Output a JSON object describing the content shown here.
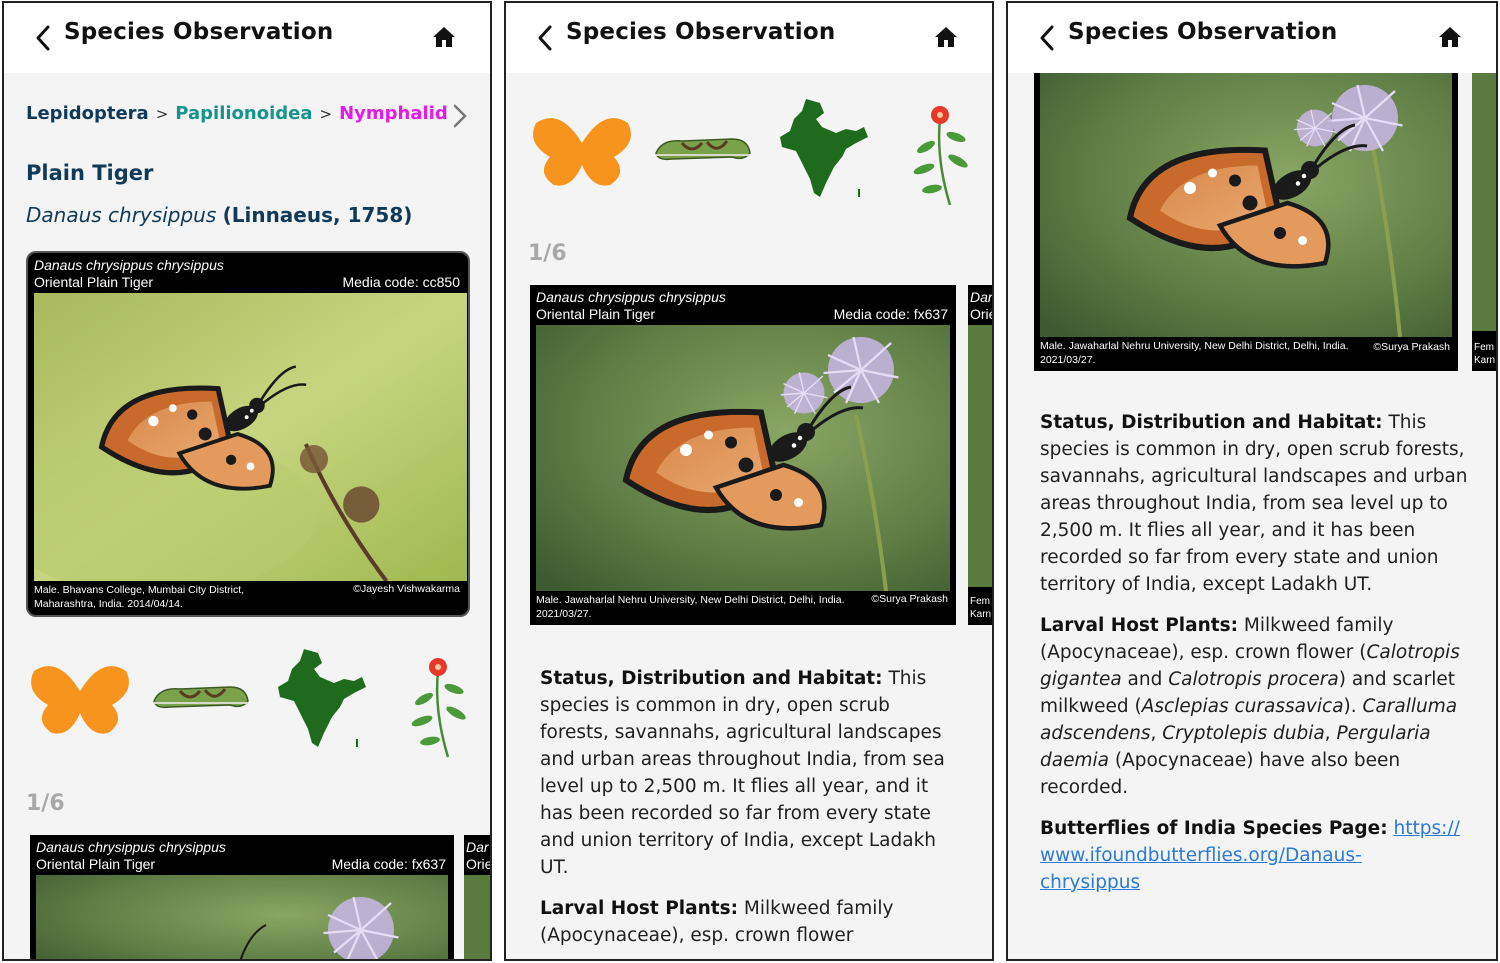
{
  "header": {
    "title": "Species Observation"
  },
  "breadcrumb": {
    "order": "Lepidoptera",
    "superfamily": "Papilionoidea",
    "family": "Nymphalid",
    "separator": ">"
  },
  "species": {
    "common_name": "Plain Tiger",
    "scientific_name": "Danaus chrysippus",
    "authority": "(Linnaeus, 1758)"
  },
  "media_cards": [
    {
      "subspecies": "Danaus chrysippus chrysippus",
      "common": "Oriental Plain Tiger",
      "media_code": "Media code: cc850",
      "location_line1": "Male. Bhavans College, Mumbai City District,",
      "location_line2": "Maharashtra, India. 2014/04/14.",
      "credit": "©Jayesh Vishwakarma"
    },
    {
      "subspecies": "Danaus chrysippus chrysippus",
      "common": "Oriental Plain Tiger",
      "media_code": "Media code: fx637",
      "location_line1": "Male. Jawaharlal Nehru University, New Delhi District, Delhi, India.",
      "location_line2": "2021/03/27.",
      "credit": "©Surya Prakash"
    }
  ],
  "peek_card": {
    "line1": "Dar",
    "line2": "Orie",
    "foot1": "Fem",
    "foot2": "Karn"
  },
  "icons": [
    "butterfly-icon",
    "caterpillar-icon",
    "india-map-icon",
    "host-plant-icon"
  ],
  "counter": "1/6",
  "description": {
    "status_label": "Status, Distribution and Habitat:",
    "status_text": "This species is common in dry, open scrub forests, savannahs, agricultural landscapes and urban areas throughout India, from sea level up to 2,500 m. It flies all year, and it has been recorded so far from every state and union territory of India, except Ladakh UT.",
    "host_label": "Larval Host Plants:",
    "host_text_1": "Milkweed family (Apocynaceae), esp. crown flower (",
    "host_sp_1": "Calotropis gigantea",
    "host_and": " and ",
    "host_sp_2": "Calotropis procera",
    "host_text_2": ") and scarlet milkweed (",
    "host_sp_3": "Asclepias curassavica",
    "host_text_3": "). ",
    "host_sp_4": "Caralluma adscendens",
    "host_comma_1": ", ",
    "host_sp_5": "Cryptolepis dubia",
    "host_comma_2": ", ",
    "host_sp_6": "Pergularia daemia",
    "host_text_4": " (Apocynaceae) have also been recorded.",
    "page_label": "Butterflies of India Species Page:",
    "page_link": "https://www.ifoundbutterflies.org/Danaus-chrysippus",
    "page_link_a": "https://",
    "page_link_b": "www.ifoundbutterflies.org/Danaus-",
    "page_link_c": "chrysippus",
    "partial_status_text": "This species is common in dry, open scrub forests, savannahs, agricultural landscapes and urban areas throughout India, from sea level up to 2,500 m. It flies all year, and it has been recorded so far from every state and union territory of India, except Ladakh UT.",
    "partial_host_text": "Milkweed family (Apocynaceae), esp. crown flower"
  },
  "colors": {
    "breadcrumb_order": "#0f3a5a",
    "breadcrumb_superfamily": "#17958c",
    "breadcrumb_family": "#e41be4",
    "link": "#2a7ad6",
    "counter": "#a8a8a8",
    "butterfly_icon": "#f7941d",
    "map_icon": "#1e6b1e"
  }
}
